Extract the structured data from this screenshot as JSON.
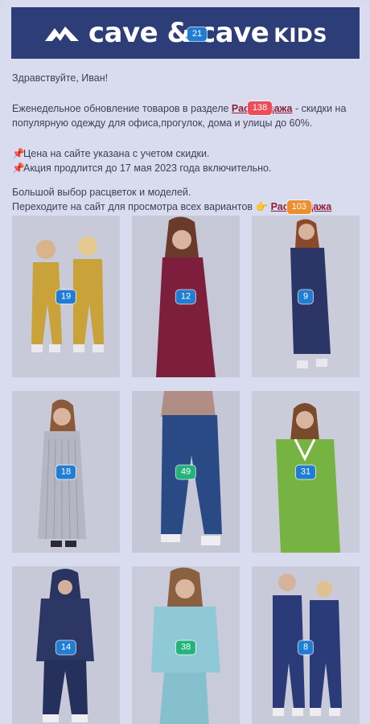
{
  "header": {
    "brand": "cave & cave",
    "sub_brand": "KIDS",
    "badge": "21"
  },
  "greeting": "Здравствуйте, Иван!",
  "intro": {
    "before": "Еженедельное обновление товаров в разделе ",
    "link": "Распродажа",
    "badge": "138",
    "after": " - скидки на популярную одежду для офиса,прогулок, дома и улицы до 60%."
  },
  "notes": [
    "Цена на сайте указана с учетом скидки.",
    "Акция продлится до 17 мая 2023 года включительно."
  ],
  "cta": {
    "line1": "Большой выбор расцветок и моделей.",
    "line2": "Переходите на сайт для просмотра всех вариантов",
    "link": "Распродажа",
    "badge": "103"
  },
  "products": [
    {
      "badge": "19",
      "badge_color": "#1f7dd6",
      "desc": "kids-yellow-jumpsuits"
    },
    {
      "badge": "12",
      "badge_color": "#1f7dd6",
      "desc": "burgundy-hoodie-dress"
    },
    {
      "badge": "9",
      "badge_color": "#1f7dd6",
      "desc": "navy-tshirt-dress"
    },
    {
      "badge": "18",
      "badge_color": "#1f7dd6",
      "desc": "striped-shirt-dress"
    },
    {
      "badge": "49",
      "badge_color": "#22b37a",
      "desc": "men-jeans"
    },
    {
      "badge": "31",
      "badge_color": "#1f7dd6",
      "desc": "green-vneck-dress"
    },
    {
      "badge": "14",
      "badge_color": "#1f7dd6",
      "desc": "navy-tracksuit"
    },
    {
      "badge": "38",
      "badge_color": "#22b37a",
      "desc": "lightblue-tracksuit"
    },
    {
      "badge": "8",
      "badge_color": "#1f7dd6",
      "desc": "kids-navy-jumpsuits"
    }
  ]
}
